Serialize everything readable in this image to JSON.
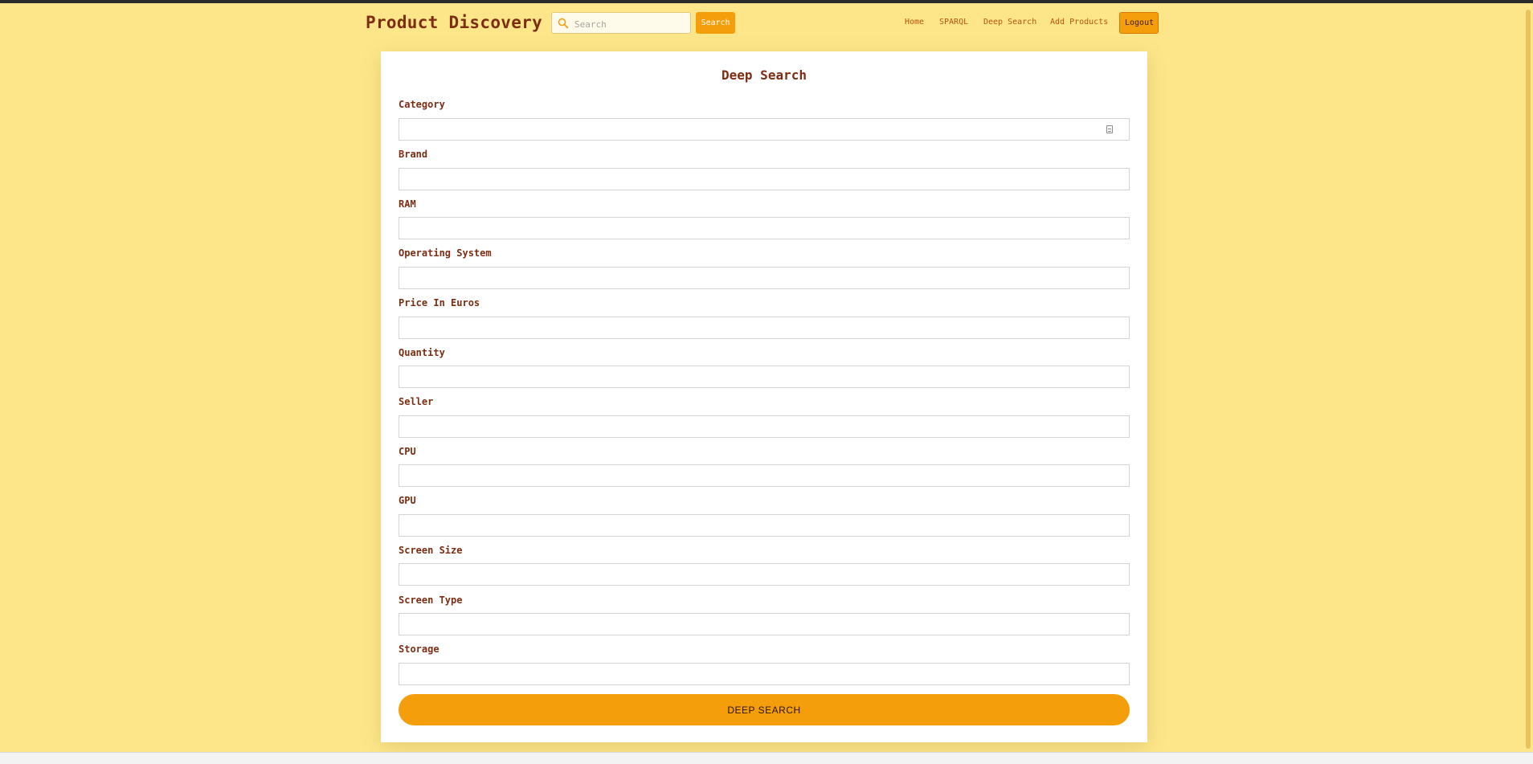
{
  "header": {
    "brand": "Product Discovery",
    "search": {
      "placeholder": "Search",
      "value": "",
      "button_label": "Search"
    },
    "nav": [
      {
        "label": "Home"
      },
      {
        "label": "SPARQL"
      },
      {
        "label": "Deep Search"
      },
      {
        "label": "Add Products"
      }
    ],
    "logout_label": "Logout"
  },
  "form": {
    "title": "Deep Search",
    "fields": [
      {
        "label": "Category",
        "value": ""
      },
      {
        "label": "Brand",
        "value": ""
      },
      {
        "label": "RAM",
        "value": ""
      },
      {
        "label": "Operating System",
        "value": ""
      },
      {
        "label": "Price In Euros",
        "value": ""
      },
      {
        "label": "Quantity",
        "value": ""
      },
      {
        "label": "Seller",
        "value": ""
      },
      {
        "label": "CPU",
        "value": ""
      },
      {
        "label": "GPU",
        "value": ""
      },
      {
        "label": "Screen Size",
        "value": ""
      },
      {
        "label": "Screen Type",
        "value": ""
      },
      {
        "label": "Storage",
        "value": ""
      }
    ],
    "submit_label": "DEEP SEARCH"
  },
  "colors": {
    "background": "#fde68a",
    "accent": "#f59e0b",
    "text": "#7c2d12"
  }
}
